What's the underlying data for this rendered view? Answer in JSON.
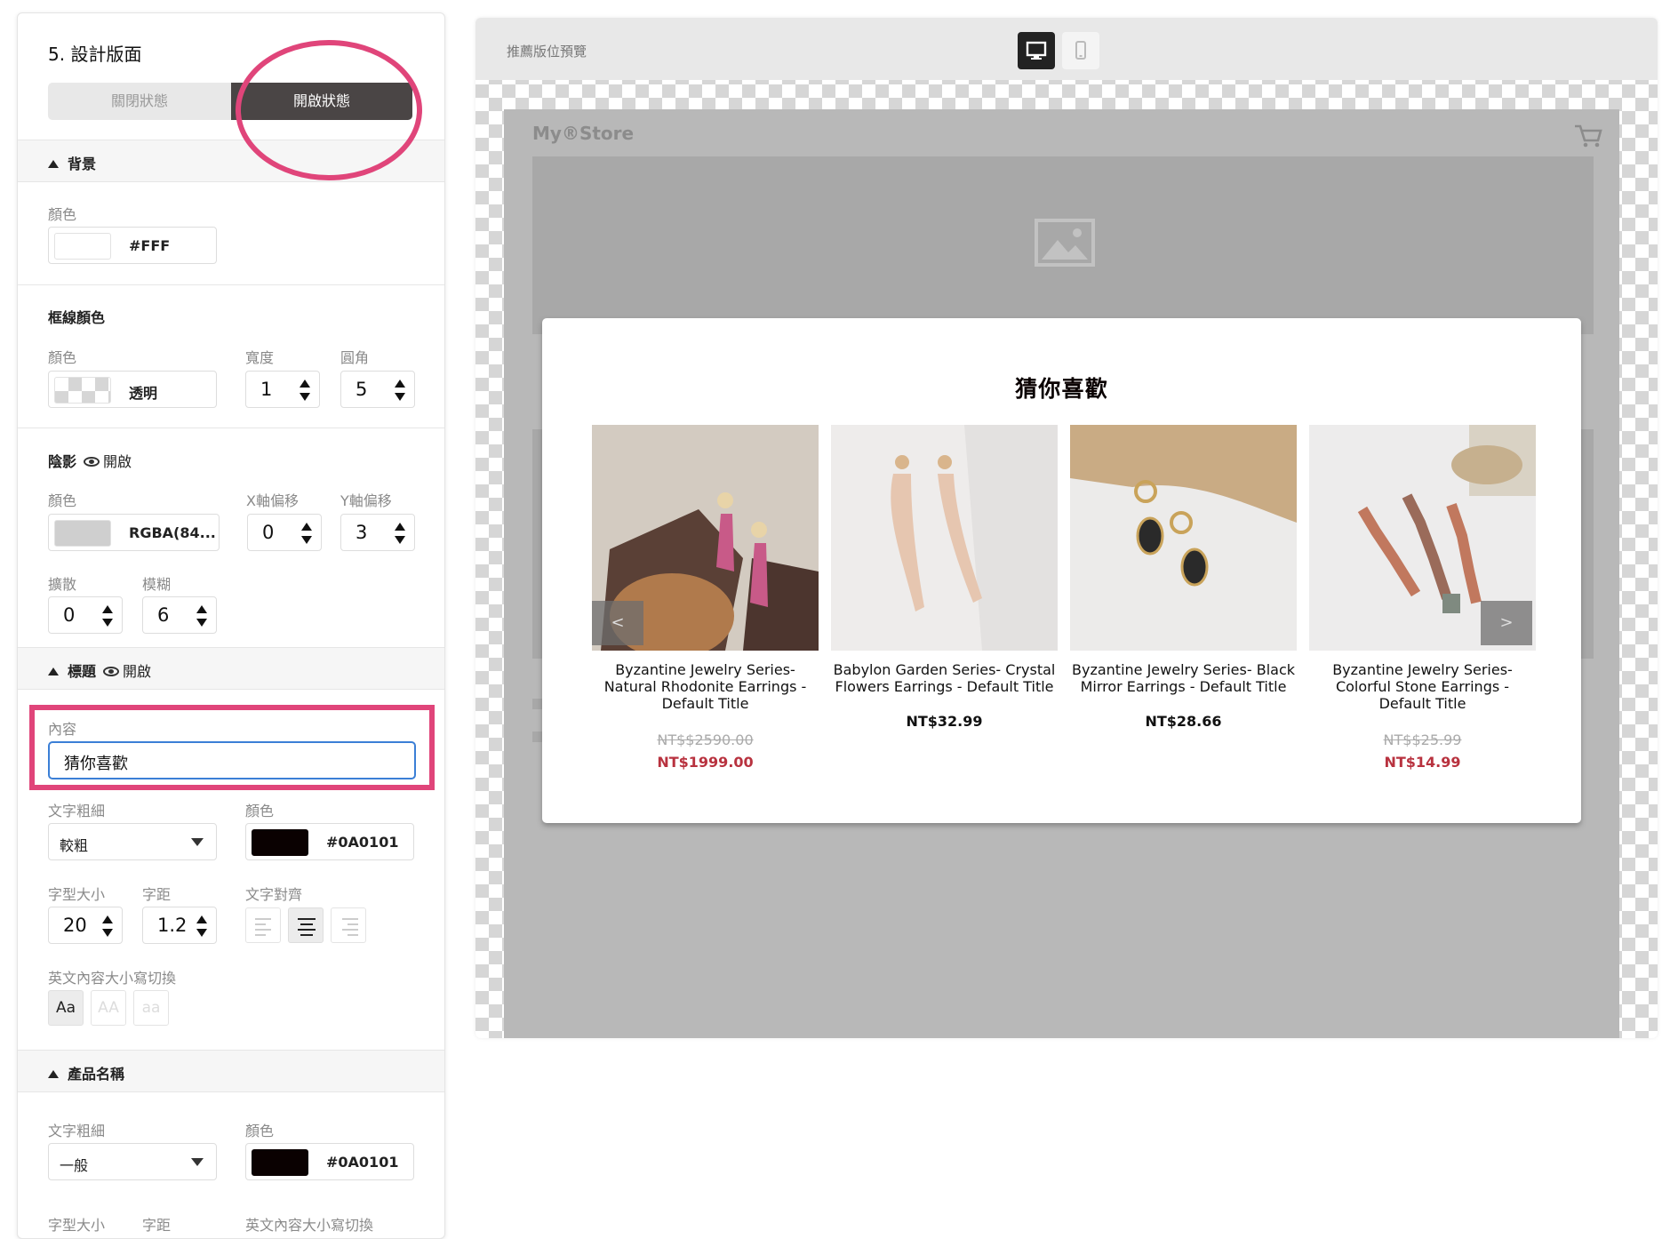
{
  "panel": {
    "step_title": "5. 設計版面",
    "toggle_closed": "關閉狀態",
    "toggle_open": "開啟狀態",
    "background": {
      "section": "背景",
      "color_label": "顏色",
      "color_hex": "#FFF",
      "color_value": "#FFFFFF"
    },
    "border": {
      "section": "框線顏色",
      "color_label": "顏色",
      "color_value_text": "透明",
      "width_label": "寬度",
      "width_value": "1",
      "radius_label": "圓角",
      "radius_value": "5"
    },
    "shadow": {
      "section": "陰影",
      "visibility": "開啟",
      "color_label": "顏色",
      "color_text": "RGBA(84...",
      "x_label": "X軸偏移",
      "x_value": "0",
      "y_label": "Y軸偏移",
      "y_value": "3",
      "spread_label": "擴散",
      "spread_value": "0",
      "blur_label": "模糊",
      "blur_value": "6"
    },
    "title_section": {
      "section": "標題",
      "visibility": "開啟",
      "content_label": "內容",
      "content_value": "猜你喜歡",
      "weight_label": "文字粗細",
      "weight_value": "較粗",
      "color_label": "顏色",
      "color_hex": "#0A0101",
      "size_label": "字型大小",
      "size_value": "20",
      "spacing_label": "字距",
      "spacing_value": "1.2",
      "align_label": "文字對齊",
      "case_label": "英文內容大小寫切換",
      "case_options": [
        "Aa",
        "AA",
        "aa"
      ]
    },
    "product_name": {
      "section": "產品名稱",
      "weight_label": "文字粗細",
      "weight_value": "一般",
      "color_label": "顏色",
      "color_hex": "#0A0101",
      "size_label": "字型大小",
      "spacing_label": "字距",
      "case_label": "英文內容大小寫切換"
    }
  },
  "preview": {
    "label": "推薦版位預覽",
    "store_name": "My®Store",
    "popup_title": "猜你喜歡",
    "products": [
      {
        "name": "Byzantine Jewelry Series- Natural Rhodonite Earrings - Default Title",
        "old_price": "NT$$2590.00",
        "price": "NT$1999.00"
      },
      {
        "name": "Babylon Garden Series- Crystal Flowers Earrings - Default Title",
        "price": "NT$32.99"
      },
      {
        "name": "Byzantine Jewelry Series- Black Mirror Earrings - Default Title",
        "price": "NT$28.66"
      },
      {
        "name": "Byzantine Jewelry Series- Colorful Stone Earrings - Default Title",
        "old_price": "NT$$25.99",
        "price": "NT$14.99"
      }
    ],
    "prev_arrow": "<",
    "next_arrow": ">"
  },
  "colors": {
    "accent_highlight": "#e0457a",
    "toggle_active": "#4a4545",
    "sale_price": "#b8323f"
  }
}
